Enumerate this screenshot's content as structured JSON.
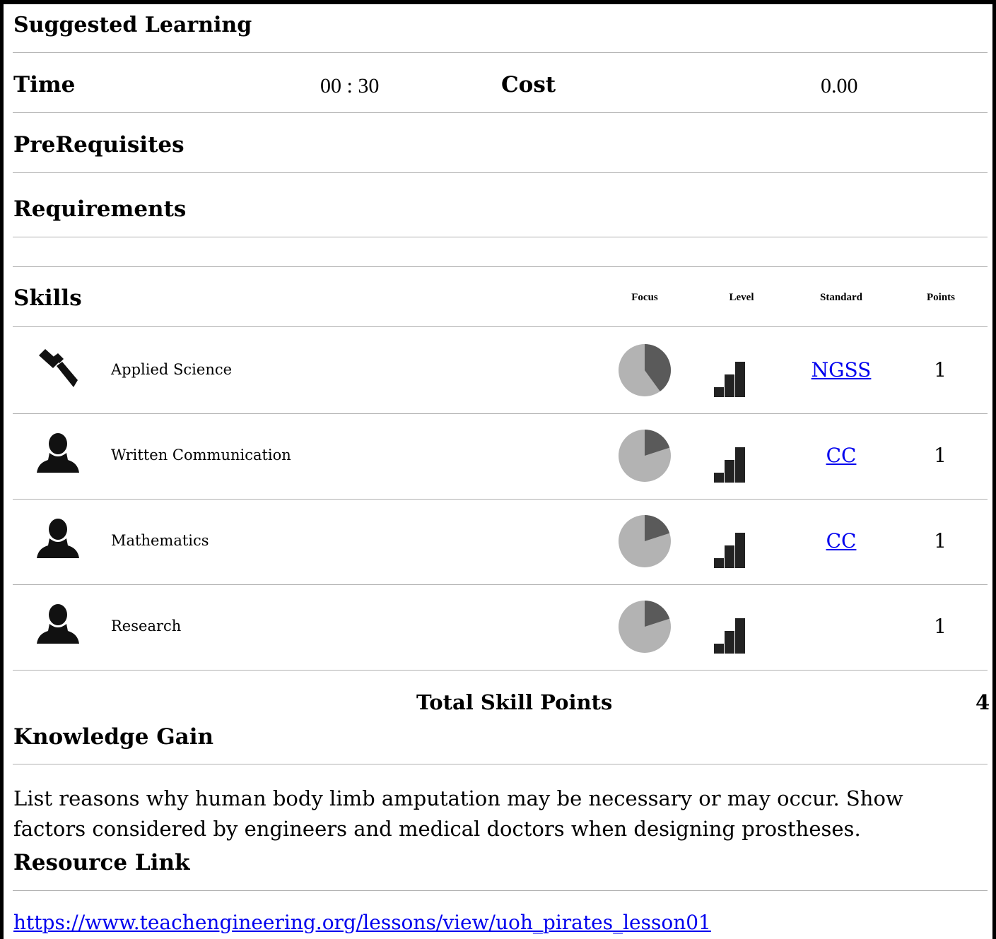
{
  "section_title": "Suggested Learning",
  "time": {
    "label": "Time",
    "value": "00 : 30"
  },
  "cost": {
    "label": "Cost",
    "value": "0.00"
  },
  "prerequisites_label": "PreRequisites",
  "requirements_label": "Requirements",
  "skills": {
    "label": "Skills",
    "columns": {
      "focus": "Focus",
      "level": "Level",
      "standard": "Standard",
      "points": "Points"
    },
    "rows": [
      {
        "icon": "hammer-icon",
        "name": "Applied Science",
        "focus_fraction": 0.4,
        "level": 3,
        "standard": "NGSS",
        "points": "1"
      },
      {
        "icon": "person-icon",
        "name": "Written Communication",
        "focus_fraction": 0.2,
        "level": 3,
        "standard": "CC",
        "points": "1"
      },
      {
        "icon": "person-icon",
        "name": "Mathematics",
        "focus_fraction": 0.2,
        "level": 3,
        "standard": "CC",
        "points": "1"
      },
      {
        "icon": "person-icon",
        "name": "Research",
        "focus_fraction": 0.2,
        "level": 3,
        "standard": "",
        "points": "1"
      }
    ],
    "total_label": "Total Skill Points",
    "total_value": "4"
  },
  "knowledge_gain": {
    "label": "Knowledge Gain",
    "text": "List reasons why human body limb amputation may be necessary or may occur. Show factors considered by engineers and medical doctors when designing prostheses."
  },
  "resource_link": {
    "label": "Resource Link",
    "url": "https://www.teachengineering.org/lessons/view/uoh_pirates_lesson01"
  },
  "colors": {
    "pie_light": "#b3b3b3",
    "pie_dark": "#5a5a5a",
    "icon": "#111111",
    "link": "#0000ee",
    "rule": "#b0b0b0"
  }
}
